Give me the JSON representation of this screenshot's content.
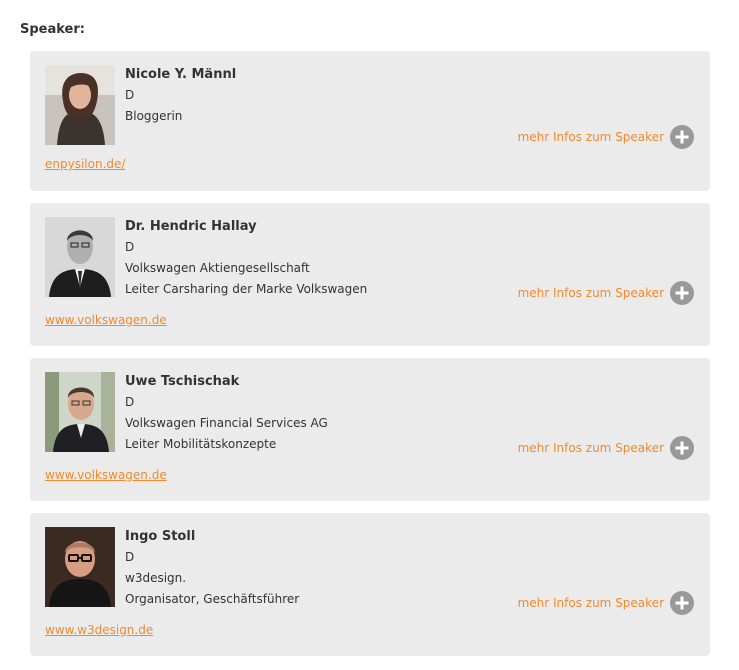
{
  "heading": "Speaker:",
  "more_label": "mehr Infos zum Speaker",
  "accent_color": "#f18a2e",
  "card_background": "#ebebeb",
  "icon": "plus-circle-icon",
  "speakers": [
    {
      "name": "Nicole Y. Männl",
      "country": "D",
      "lines": [
        "Bloggerin"
      ],
      "website": "enpysilon.de/"
    },
    {
      "name": "Dr. Hendric Hallay",
      "country": "D",
      "lines": [
        "Volkswagen Aktiengesellschaft",
        "Leiter Carsharing der Marke Volkswagen"
      ],
      "website": "www.volkswagen.de"
    },
    {
      "name": "Uwe Tschischak",
      "country": "D",
      "lines": [
        "Volkswagen Financial Services AG",
        "Leiter Mobilitätskonzepte"
      ],
      "website": "www.volkswagen.de"
    },
    {
      "name": "Ingo Stoll",
      "country": "D",
      "lines": [
        "w3design.",
        "Organisator, Geschäftsführer"
      ],
      "website": "www.w3design.de"
    }
  ]
}
